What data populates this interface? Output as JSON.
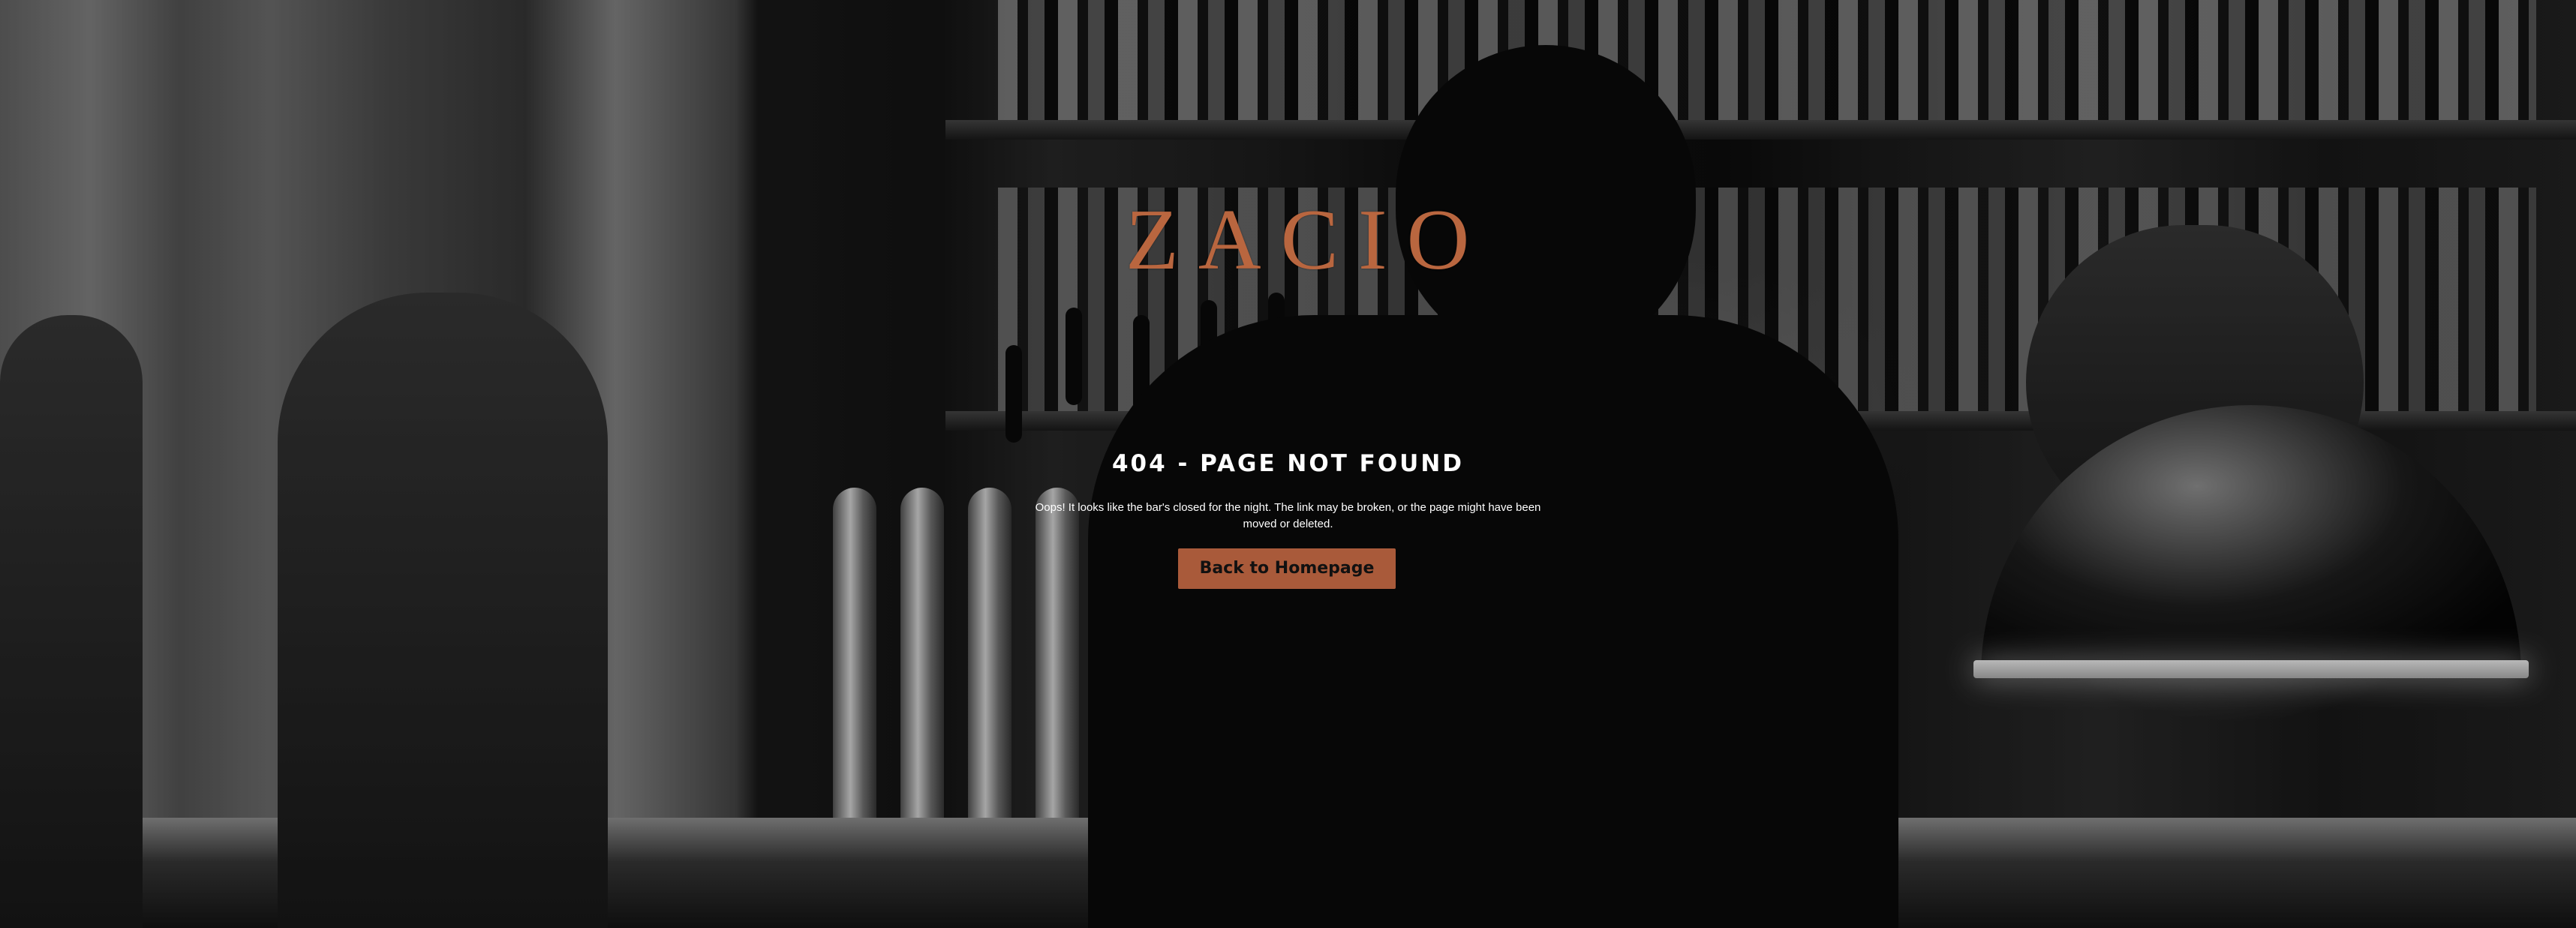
{
  "brand": {
    "logo_text": "ZACIO",
    "accent_color": "#b9663f",
    "button_color": "#a95a3a"
  },
  "error": {
    "heading": "404 - PAGE NOT FOUND",
    "message": "Oops! It looks like the bar's closed for the night. The link may be broken, or the page might have been moved or deleted."
  },
  "actions": {
    "home_button_label": "Back to Homepage"
  },
  "background": {
    "description_icon": "bar-photo-background"
  }
}
